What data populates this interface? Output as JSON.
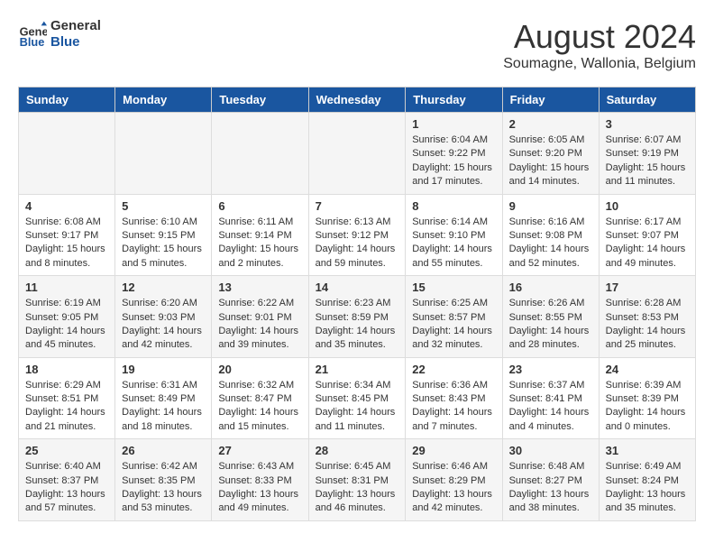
{
  "logo": {
    "text_general": "General",
    "text_blue": "Blue"
  },
  "header": {
    "month_year": "August 2024",
    "location": "Soumagne, Wallonia, Belgium"
  },
  "weekdays": [
    "Sunday",
    "Monday",
    "Tuesday",
    "Wednesday",
    "Thursday",
    "Friday",
    "Saturday"
  ],
  "weeks": [
    [
      {
        "day": "",
        "info": ""
      },
      {
        "day": "",
        "info": ""
      },
      {
        "day": "",
        "info": ""
      },
      {
        "day": "",
        "info": ""
      },
      {
        "day": "1",
        "info": "Sunrise: 6:04 AM\nSunset: 9:22 PM\nDaylight: 15 hours and 17 minutes."
      },
      {
        "day": "2",
        "info": "Sunrise: 6:05 AM\nSunset: 9:20 PM\nDaylight: 15 hours and 14 minutes."
      },
      {
        "day": "3",
        "info": "Sunrise: 6:07 AM\nSunset: 9:19 PM\nDaylight: 15 hours and 11 minutes."
      }
    ],
    [
      {
        "day": "4",
        "info": "Sunrise: 6:08 AM\nSunset: 9:17 PM\nDaylight: 15 hours and 8 minutes."
      },
      {
        "day": "5",
        "info": "Sunrise: 6:10 AM\nSunset: 9:15 PM\nDaylight: 15 hours and 5 minutes."
      },
      {
        "day": "6",
        "info": "Sunrise: 6:11 AM\nSunset: 9:14 PM\nDaylight: 15 hours and 2 minutes."
      },
      {
        "day": "7",
        "info": "Sunrise: 6:13 AM\nSunset: 9:12 PM\nDaylight: 14 hours and 59 minutes."
      },
      {
        "day": "8",
        "info": "Sunrise: 6:14 AM\nSunset: 9:10 PM\nDaylight: 14 hours and 55 minutes."
      },
      {
        "day": "9",
        "info": "Sunrise: 6:16 AM\nSunset: 9:08 PM\nDaylight: 14 hours and 52 minutes."
      },
      {
        "day": "10",
        "info": "Sunrise: 6:17 AM\nSunset: 9:07 PM\nDaylight: 14 hours and 49 minutes."
      }
    ],
    [
      {
        "day": "11",
        "info": "Sunrise: 6:19 AM\nSunset: 9:05 PM\nDaylight: 14 hours and 45 minutes."
      },
      {
        "day": "12",
        "info": "Sunrise: 6:20 AM\nSunset: 9:03 PM\nDaylight: 14 hours and 42 minutes."
      },
      {
        "day": "13",
        "info": "Sunrise: 6:22 AM\nSunset: 9:01 PM\nDaylight: 14 hours and 39 minutes."
      },
      {
        "day": "14",
        "info": "Sunrise: 6:23 AM\nSunset: 8:59 PM\nDaylight: 14 hours and 35 minutes."
      },
      {
        "day": "15",
        "info": "Sunrise: 6:25 AM\nSunset: 8:57 PM\nDaylight: 14 hours and 32 minutes."
      },
      {
        "day": "16",
        "info": "Sunrise: 6:26 AM\nSunset: 8:55 PM\nDaylight: 14 hours and 28 minutes."
      },
      {
        "day": "17",
        "info": "Sunrise: 6:28 AM\nSunset: 8:53 PM\nDaylight: 14 hours and 25 minutes."
      }
    ],
    [
      {
        "day": "18",
        "info": "Sunrise: 6:29 AM\nSunset: 8:51 PM\nDaylight: 14 hours and 21 minutes."
      },
      {
        "day": "19",
        "info": "Sunrise: 6:31 AM\nSunset: 8:49 PM\nDaylight: 14 hours and 18 minutes."
      },
      {
        "day": "20",
        "info": "Sunrise: 6:32 AM\nSunset: 8:47 PM\nDaylight: 14 hours and 15 minutes."
      },
      {
        "day": "21",
        "info": "Sunrise: 6:34 AM\nSunset: 8:45 PM\nDaylight: 14 hours and 11 minutes."
      },
      {
        "day": "22",
        "info": "Sunrise: 6:36 AM\nSunset: 8:43 PM\nDaylight: 14 hours and 7 minutes."
      },
      {
        "day": "23",
        "info": "Sunrise: 6:37 AM\nSunset: 8:41 PM\nDaylight: 14 hours and 4 minutes."
      },
      {
        "day": "24",
        "info": "Sunrise: 6:39 AM\nSunset: 8:39 PM\nDaylight: 14 hours and 0 minutes."
      }
    ],
    [
      {
        "day": "25",
        "info": "Sunrise: 6:40 AM\nSunset: 8:37 PM\nDaylight: 13 hours and 57 minutes."
      },
      {
        "day": "26",
        "info": "Sunrise: 6:42 AM\nSunset: 8:35 PM\nDaylight: 13 hours and 53 minutes."
      },
      {
        "day": "27",
        "info": "Sunrise: 6:43 AM\nSunset: 8:33 PM\nDaylight: 13 hours and 49 minutes."
      },
      {
        "day": "28",
        "info": "Sunrise: 6:45 AM\nSunset: 8:31 PM\nDaylight: 13 hours and 46 minutes."
      },
      {
        "day": "29",
        "info": "Sunrise: 6:46 AM\nSunset: 8:29 PM\nDaylight: 13 hours and 42 minutes."
      },
      {
        "day": "30",
        "info": "Sunrise: 6:48 AM\nSunset: 8:27 PM\nDaylight: 13 hours and 38 minutes."
      },
      {
        "day": "31",
        "info": "Sunrise: 6:49 AM\nSunset: 8:24 PM\nDaylight: 13 hours and 35 minutes."
      }
    ]
  ]
}
